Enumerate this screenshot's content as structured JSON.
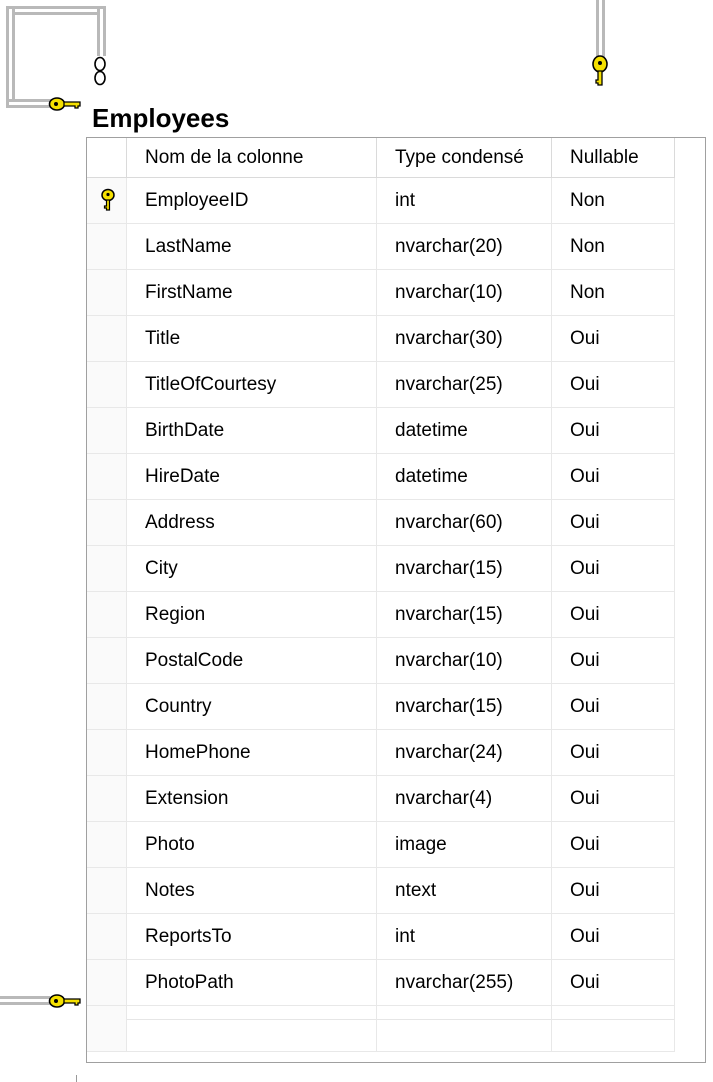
{
  "table": {
    "name": "Employees",
    "columns": {
      "col_name": "Nom de la colonne",
      "col_type": "Type condensé",
      "col_nullable": "Nullable"
    },
    "rows": [
      {
        "name": "EmployeeID",
        "type": "int",
        "nullable": "Non",
        "primary_key": true
      },
      {
        "name": "LastName",
        "type": "nvarchar(20)",
        "nullable": "Non"
      },
      {
        "name": "FirstName",
        "type": "nvarchar(10)",
        "nullable": "Non"
      },
      {
        "name": "Title",
        "type": "nvarchar(30)",
        "nullable": "Oui"
      },
      {
        "name": "TitleOfCourtesy",
        "type": "nvarchar(25)",
        "nullable": "Oui"
      },
      {
        "name": "BirthDate",
        "type": "datetime",
        "nullable": "Oui"
      },
      {
        "name": "HireDate",
        "type": "datetime",
        "nullable": "Oui"
      },
      {
        "name": "Address",
        "type": "nvarchar(60)",
        "nullable": "Oui"
      },
      {
        "name": "City",
        "type": "nvarchar(15)",
        "nullable": "Oui"
      },
      {
        "name": "Region",
        "type": "nvarchar(15)",
        "nullable": "Oui"
      },
      {
        "name": "PostalCode",
        "type": "nvarchar(10)",
        "nullable": "Oui"
      },
      {
        "name": "Country",
        "type": "nvarchar(15)",
        "nullable": "Oui"
      },
      {
        "name": "HomePhone",
        "type": "nvarchar(24)",
        "nullable": "Oui"
      },
      {
        "name": "Extension",
        "type": "nvarchar(4)",
        "nullable": "Oui"
      },
      {
        "name": "Photo",
        "type": "image",
        "nullable": "Oui"
      },
      {
        "name": "Notes",
        "type": "ntext",
        "nullable": "Oui"
      },
      {
        "name": "ReportsTo",
        "type": "int",
        "nullable": "Oui"
      },
      {
        "name": "PhotoPath",
        "type": "nvarchar(255)",
        "nullable": "Oui"
      },
      {
        "name": "",
        "type": "",
        "nullable": ""
      }
    ]
  },
  "colors": {
    "key_yellow": "#f5e000",
    "key_outline": "#000000",
    "connector_gray": "#b9b9b9"
  },
  "icons": {
    "primary_key": "key-icon",
    "relationship_end_one": "key-icon",
    "relationship_end_many": "infinity-icon"
  }
}
